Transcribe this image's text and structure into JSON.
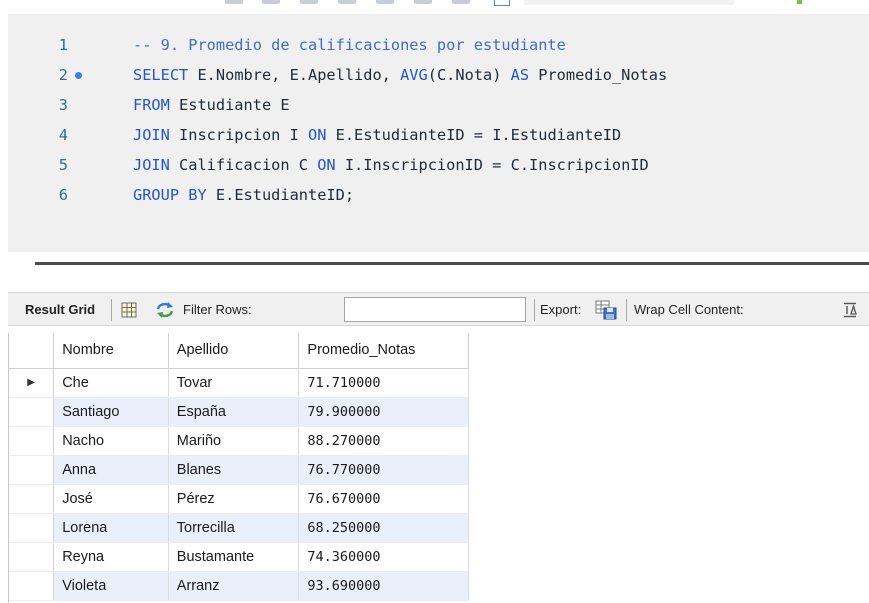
{
  "editor": {
    "lines": [
      {
        "number": "1",
        "segments": [
          {
            "text": "-- 9. Promedio de calificaciones por estudiante",
            "cls": "cm"
          }
        ]
      },
      {
        "number": "2",
        "segments": [
          {
            "text": "SELECT",
            "cls": "kw"
          },
          {
            "text": " E.Nombre, E.Apellido, "
          },
          {
            "text": "AVG",
            "cls": "kw"
          },
          {
            "text": "(C.Nota) "
          },
          {
            "text": "AS",
            "cls": "kw"
          },
          {
            "text": " Promedio_Notas"
          }
        ]
      },
      {
        "number": "3",
        "segments": [
          {
            "text": "FROM",
            "cls": "kw"
          },
          {
            "text": " Estudiante E"
          }
        ]
      },
      {
        "number": "4",
        "segments": [
          {
            "text": "JOIN",
            "cls": "kw"
          },
          {
            "text": " Inscripcion I "
          },
          {
            "text": "ON",
            "cls": "kw"
          },
          {
            "text": " E.EstudianteID = I.EstudianteID"
          }
        ]
      },
      {
        "number": "5",
        "segments": [
          {
            "text": "JOIN",
            "cls": "kw"
          },
          {
            "text": " Calificacion C "
          },
          {
            "text": "ON",
            "cls": "kw"
          },
          {
            "text": " I.InscripcionID = C.InscripcionID"
          }
        ]
      },
      {
        "number": "6",
        "segments": [
          {
            "text": "GROUP BY",
            "cls": "kw"
          },
          {
            "text": " E.EstudianteID;"
          }
        ]
      }
    ]
  },
  "result_toolbar": {
    "result_grid_label": "Result Grid",
    "filter_label": "Filter Rows:",
    "filter_value": "",
    "export_label": "Export:",
    "wrap_label": "Wrap Cell Content:"
  },
  "grid": {
    "columns": [
      "Nombre",
      "Apellido",
      "Promedio_Notas"
    ],
    "rows": [
      [
        "Che",
        "Tovar",
        "71.710000"
      ],
      [
        "Santiago",
        "España",
        "79.900000"
      ],
      [
        "Nacho",
        "Mariño",
        "88.270000"
      ],
      [
        "Anna",
        "Blanes",
        "76.770000"
      ],
      [
        "José",
        "Pérez",
        "76.670000"
      ],
      [
        "Lorena",
        "Torrecilla",
        "68.250000"
      ],
      [
        "Reyna",
        "Bustamante",
        "74.360000"
      ],
      [
        "Violeta",
        "Arranz",
        "93.690000"
      ]
    ]
  },
  "colors": {
    "keyword": "#2456c6",
    "comment": "#3f6dc7",
    "line_number": "#2e6f8f",
    "marker_dot": "#3e7de4",
    "row_alt": "#e9f0fb"
  }
}
